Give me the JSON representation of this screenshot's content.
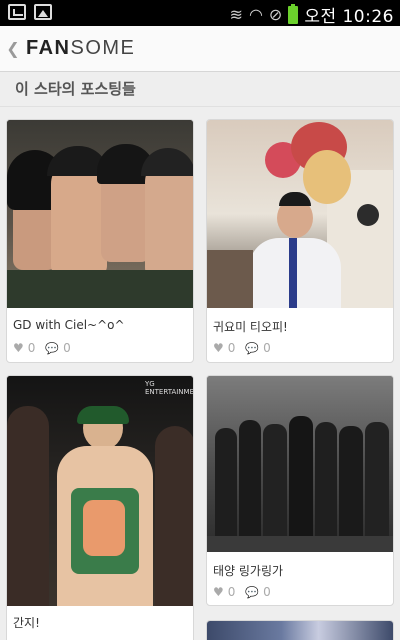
{
  "status_bar": {
    "left_icons": [
      "usb-icon",
      "image-icon"
    ],
    "right_icons": [
      "vibrate-icon",
      "wifi-icon",
      "no-sim-icon",
      "battery-icon"
    ],
    "time": "오전 10:26"
  },
  "app_bar": {
    "logo_bold": "FAN",
    "logo_light": "SOME"
  },
  "section_title": "이 스타의 포스팅들",
  "posts": [
    {
      "caption": "GD with Ciel~^o^",
      "likes": "0",
      "comments": "0"
    },
    {
      "caption": "귀요미 티오피!",
      "likes": "0",
      "comments": "0"
    },
    {
      "caption": "간지!",
      "likes": "",
      "comments": ""
    },
    {
      "caption": "태양 링가링가",
      "likes": "0",
      "comments": "0"
    }
  ],
  "photo_labels": {
    "post3_watermark": "YG ENTERTAINMENT"
  },
  "colors": {
    "accent_battery": "#6bd12c",
    "status_bar_bg": "#000000",
    "page_bg": "#eeeeee"
  }
}
